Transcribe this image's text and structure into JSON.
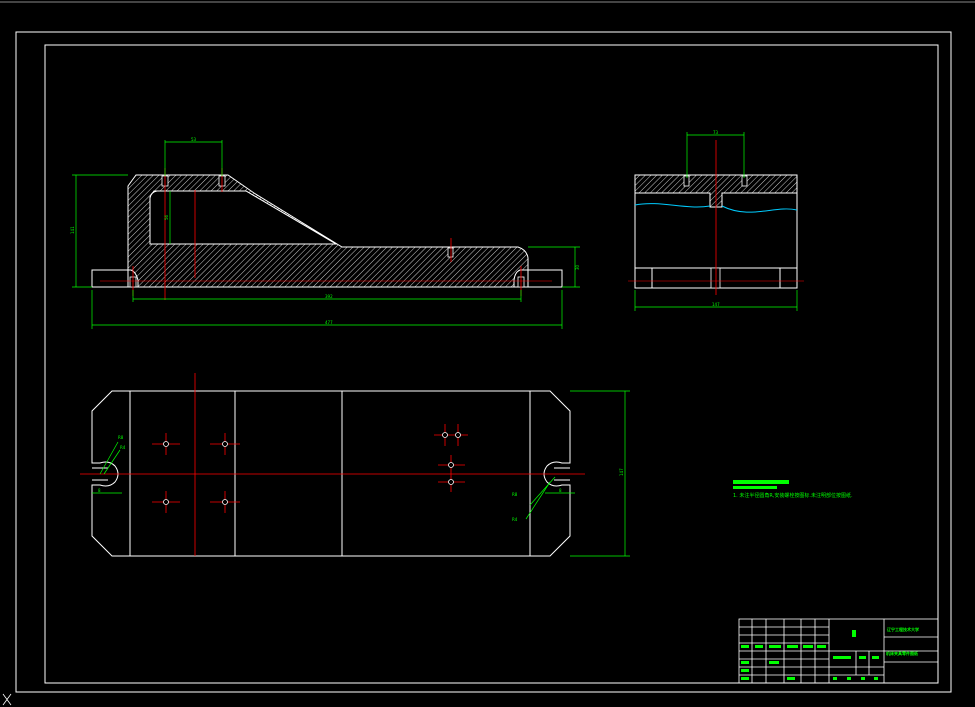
{
  "drawing": {
    "background": "#000000",
    "line_color": "#ffffff",
    "center_color": "#ff0000",
    "dimension_color": "#00ff00",
    "hatch_color": "#ffffff"
  },
  "front_view": {
    "dims": {
      "top_width": "53",
      "overall_height": "141",
      "inner_height": "56",
      "right_height": "30",
      "inner_length": "392",
      "overall_length": "477"
    }
  },
  "side_view": {
    "dims": {
      "top_width": "73",
      "width": "147"
    }
  },
  "plan_view": {
    "dims": {
      "left_r_top": "R8",
      "left_r_low": "R4",
      "left_slot": "8",
      "right_r_top": "R8",
      "right_r_low": "R4",
      "right_slot": "8",
      "height": "147"
    }
  },
  "notes": {
    "title_text": "",
    "line1": "1. 未注半径圆角R,安装螺栓按图标.未注明部位按图纸."
  },
  "title_block": {
    "school": "辽宁工程技术大学",
    "drawing_name": "机床夹具零件图纸",
    "scale": "1:1",
    "sheet": "1"
  }
}
